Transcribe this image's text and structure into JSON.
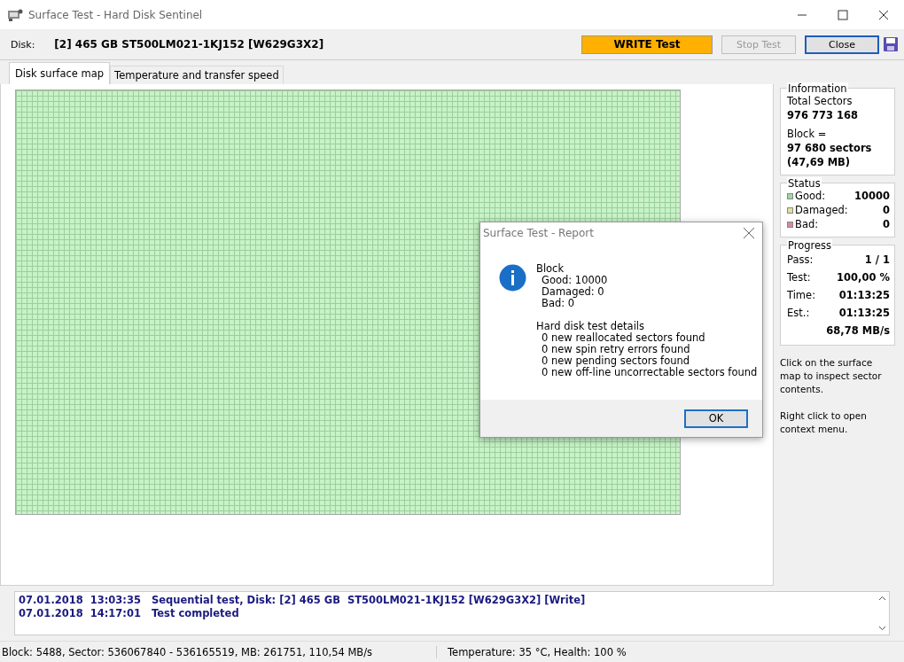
{
  "window": {
    "title": "Surface Test - Hard Disk Sentinel"
  },
  "disk": {
    "label": "Disk:",
    "value": "[2] 465 GB  ST500LM021-1KJ152 [W629G3X2]"
  },
  "buttons": [
    {
      "label": "WRITE Test",
      "kind": "mode",
      "disabled": false
    },
    {
      "label": "Stop Test",
      "kind": "normal",
      "disabled": true
    },
    {
      "label": "Close",
      "kind": "default",
      "disabled": false
    }
  ],
  "tabs": [
    {
      "label": "Disk surface map",
      "selected": true
    },
    {
      "label": "Temperature and transfer speed",
      "selected": false
    }
  ],
  "information": {
    "title": "Information",
    "lines": [
      {
        "text": "Total Sectors",
        "bold": false
      },
      {
        "text": "976 773 168",
        "bold": true
      },
      {
        "text": "Block =",
        "bold": false
      },
      {
        "text": "97 680 sectors",
        "bold": true
      },
      {
        "text": "(47,69 MB)",
        "bold": true
      }
    ]
  },
  "status": {
    "title": "Status",
    "items": [
      {
        "label": "Good:",
        "value": "10000",
        "color": "#9fd8a4"
      },
      {
        "label": "Damaged:",
        "value": "0",
        "color": "#e0e0a0"
      },
      {
        "label": "Bad:",
        "value": "0",
        "color": "#d88a9a"
      }
    ]
  },
  "progress": {
    "title": "Progress",
    "rows": [
      {
        "label": "Pass:",
        "value": "1 / 1"
      },
      {
        "label": "Test:",
        "value": "100,00 %"
      },
      {
        "label": "Time:",
        "value": "01:13:25"
      },
      {
        "label": "Est.:",
        "value": "01:13:25"
      }
    ],
    "speed": "68,78 MB/s"
  },
  "hints": [
    "Click on the surface map to inspect sector contents.",
    "Right click to open context menu."
  ],
  "dialog": {
    "title": "Surface Test - Report",
    "sections": [
      {
        "heading": "Block",
        "lines": [
          "Good: 10000",
          "Damaged: 0",
          "Bad: 0"
        ]
      },
      {
        "heading": "Hard disk test details",
        "lines": [
          "0 new reallocated sectors found",
          "0 new spin retry errors found",
          "0 new pending sectors found",
          "0 new off-line uncorrectable sectors found"
        ]
      }
    ],
    "button": "OK"
  },
  "log": [
    {
      "date": "07.01.2018",
      "time": "13:03:35",
      "message": "Sequential test, Disk: [2] 465 GB  ST500LM021-1KJ152 [W629G3X2] [Write]"
    },
    {
      "date": "07.01.2018",
      "time": "14:17:01",
      "message": "Test completed"
    }
  ],
  "status_bar": [
    "Block: 5488, Sector: 536067840 - 536165519, MB: 261751, 110,54 MB/s",
    "Temperature: 35  °C,  Health: 100 %"
  ]
}
